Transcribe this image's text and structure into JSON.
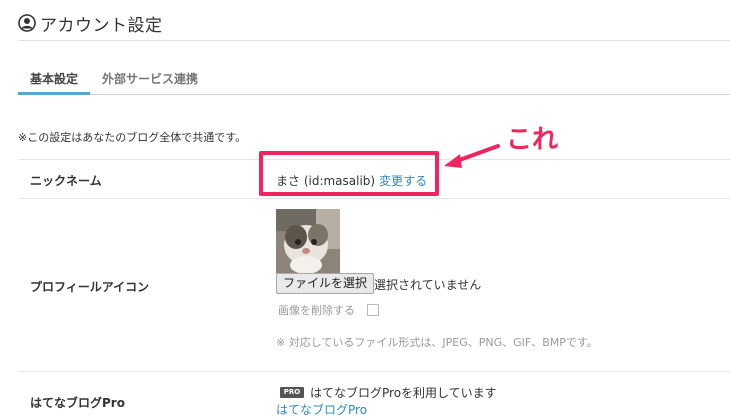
{
  "page": {
    "title": "アカウント設定",
    "tabs": [
      {
        "label": "基本設定",
        "active": true
      },
      {
        "label": "外部サービス連携",
        "active": false
      }
    ],
    "note": "※この設定はあなたのブログ全体で共通です。"
  },
  "nickname": {
    "label": "ニックネーム",
    "value": "まさ (id:masalib)",
    "change_link": "変更する"
  },
  "profile_icon": {
    "label": "プロフィールアイコン",
    "file_button": "ファイルを選択",
    "file_status": "選択されていません",
    "delete_label": "画像を削除する",
    "delete_checked": false,
    "formats_note": "※ 対応しているファイル形式は、JPEG、PNG、GIF、BMPです。"
  },
  "blog_pro": {
    "label": "はてなブログPro",
    "badge": "PRO",
    "status": "はてなブログProを利用しています",
    "link": "はてなブログPro"
  },
  "annotation": {
    "text": "これ",
    "color": "#f0245f"
  },
  "colors": {
    "accent": "#56a5d0",
    "link": "#2a8bc4",
    "annotation": "#f0245f"
  }
}
